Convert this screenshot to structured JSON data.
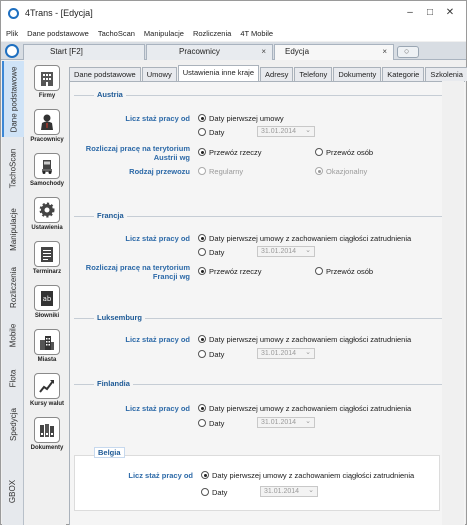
{
  "window": {
    "title": "4Trans - [Edycja]",
    "minimize": "–",
    "maximize": "□",
    "close": "✕"
  },
  "menu": [
    "Plik",
    "Dane podstawowe",
    "TachoScan",
    "Manipulacje",
    "Rozliczenia",
    "4T Mobile"
  ],
  "doc_tabs": [
    {
      "label": "Start [F2]",
      "close": ""
    },
    {
      "label": "Pracownicy",
      "close": "×"
    },
    {
      "label": "Edycja",
      "close": "×"
    }
  ],
  "add_tab_glyph": "○",
  "vnav": [
    "Dane podstawowe",
    "TachoScan",
    "Manipulacje",
    "Rozliczenia",
    "Mobile",
    "Flota",
    "Spedycja",
    "GBOX"
  ],
  "icons": [
    {
      "label": "Firmy",
      "icon": "building-icon"
    },
    {
      "label": "Pracownicy",
      "icon": "person-icon"
    },
    {
      "label": "Samochody",
      "icon": "truck-icon"
    },
    {
      "label": "Ustawienia",
      "icon": "gear-icon"
    },
    {
      "label": "Terminarz",
      "icon": "calendar-icon"
    },
    {
      "label": "Słowniki",
      "icon": "dictionary-icon"
    },
    {
      "label": "Miasta",
      "icon": "city-icon"
    },
    {
      "label": "Kursy walut",
      "icon": "chart-icon"
    },
    {
      "label": "Dokumenty",
      "icon": "documents-icon"
    }
  ],
  "inner_tabs": [
    "Dane podstawowe",
    "Umowy",
    "Ustawienia inne kraje",
    "Adresy",
    "Telefony",
    "Dokumenty",
    "Kategorie",
    "Szkolenia"
  ],
  "labels": {
    "staz": "Licz staż pracy od",
    "rozliczaj_at": "Rozliczaj pracę na terytorium Austrii wg",
    "rodzaj": "Rodzaj przewozu",
    "rozliczaj_fr": "Rozliczaj pracę na terytorium Francji wg"
  },
  "options": {
    "daty_umowy": "Daty pierwszej umowy",
    "daty_umowy_ciag": "Daty pierwszej umowy z zachowaniem ciągłości zatrudnienia",
    "daty": "Daty",
    "przewoz_rzeczy": "Przewóz rzeczy",
    "przewoz_osob": "Przewóz osób",
    "regularny": "Regularny",
    "okazjonalny": "Okazjonalny"
  },
  "date_value": "31.01.2014",
  "sections": {
    "austria": "Austria",
    "francja": "Francja",
    "luksemburg": "Luksemburg",
    "finlandia": "Finlandia",
    "belgia": "Belgia"
  }
}
